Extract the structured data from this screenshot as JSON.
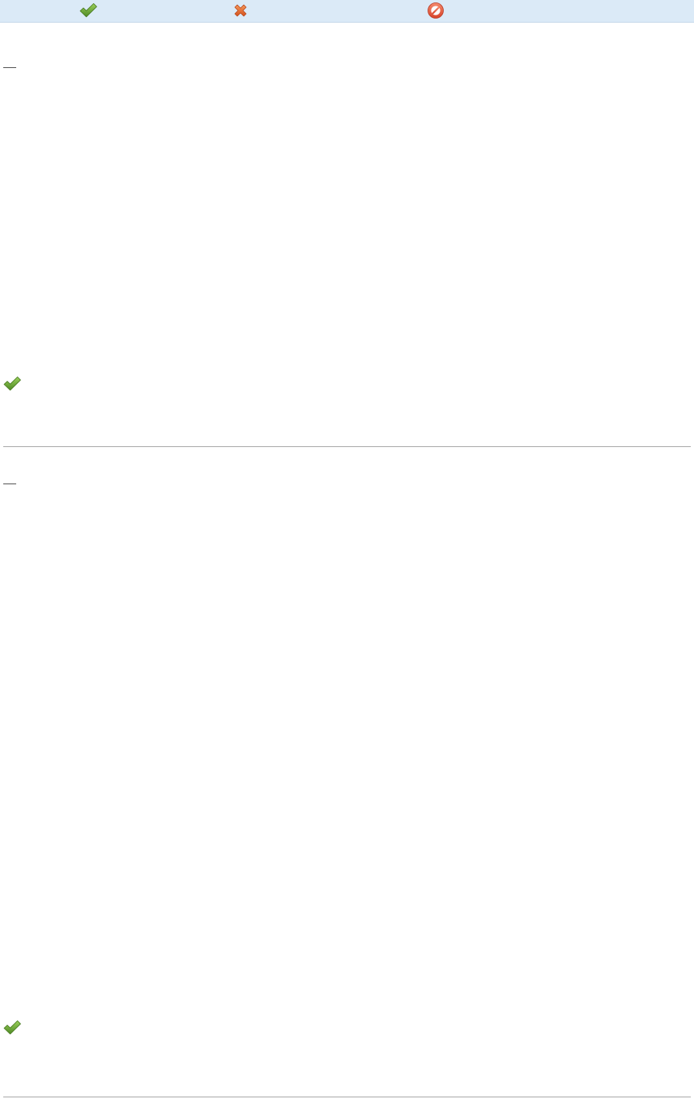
{
  "legend": {
    "items": [
      {
        "icon": "check-icon",
        "color": "#5e9a32"
      },
      {
        "icon": "cross-icon",
        "color": "#e2672d"
      },
      {
        "icon": "prohibited-icon",
        "color": "#e35a3c"
      }
    ]
  },
  "sections": [
    {
      "link_text": "",
      "status_icon": "check-icon"
    },
    {
      "link_text": "",
      "status_icon": "check-icon"
    }
  ],
  "colors": {
    "header_background": "#dbeaf7",
    "divider": "#aaaaaa",
    "check_green": "#5e9a32",
    "cross_orange": "#e2672d",
    "prohibited_red": "#e35a3c"
  }
}
